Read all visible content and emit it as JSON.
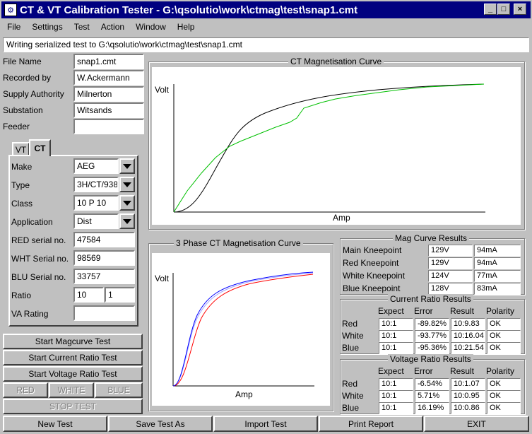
{
  "window": {
    "title": "CT & VT Calibration Tester - G:\\qsolutio\\work\\ctmag\\test\\snap1.cmt",
    "minimize": "_",
    "maximize": "□",
    "close": "×"
  },
  "menu": [
    "File",
    "Settings",
    "Test",
    "Action",
    "Window",
    "Help"
  ],
  "status": "Writing serialized test to G:\\qsolutio\\work\\ctmag\\test\\snap1.cmt",
  "info": {
    "file_name_label": "File Name",
    "file_name": "snap1.cmt",
    "recorded_by_label": "Recorded by",
    "recorded_by": "W.Ackermann",
    "supply_authority_label": "Supply Authority",
    "supply_authority": "Milnerton",
    "substation_label": "Substation",
    "substation": "Witsands",
    "feeder_label": "Feeder",
    "feeder": ""
  },
  "tabs": {
    "vt": "VT",
    "ct": "CT"
  },
  "ct": {
    "make_label": "Make",
    "make": "AEG",
    "type_label": "Type",
    "type": "3H/CT/938",
    "class_label": "Class",
    "class": "10 P 10",
    "application_label": "Application",
    "application": "Dist",
    "red_serial_label": "RED serial no.",
    "red_serial": "47584",
    "wht_serial_label": "WHT Serial no.",
    "wht_serial": "98569",
    "blu_serial_label": "BLU Serial no.",
    "blu_serial": "33757",
    "ratio_label": "Ratio",
    "ratio_primary": "10",
    "ratio_secondary": "1",
    "va_rating_label": "VA Rating",
    "va_rating": ""
  },
  "buttons": {
    "start_magcurve": "Start Magcurve Test",
    "start_current_ratio": "Start Current Ratio Test",
    "start_voltage_ratio": "Start Voltage Ratio Test",
    "red": "RED",
    "white": "WHITE",
    "blue": "BLUE",
    "stop": "STOP TEST"
  },
  "bottom": {
    "new_test": "New Test",
    "save_test_as": "Save Test As",
    "import_test": "Import Test",
    "print_report": "Print Report",
    "exit": "EXIT"
  },
  "ct_curve": {
    "title": "CT Magnetisation Curve",
    "ylabel": "Volt",
    "xlabel": "Amp"
  },
  "phase_curve": {
    "title": "3 Phase CT Magnetisation Curve",
    "ylabel": "Volt",
    "xlabel": "Amp"
  },
  "mag_results": {
    "title": "Mag Curve Results",
    "rows": [
      {
        "label": "Main Kneepoint",
        "v": "129V",
        "a": "94mA"
      },
      {
        "label": "Red Kneepoint",
        "v": "129V",
        "a": "94mA"
      },
      {
        "label": "White Kneepoint",
        "v": "124V",
        "a": "77mA"
      },
      {
        "label": "Blue Kneepoint",
        "v": "128V",
        "a": "83mA"
      }
    ]
  },
  "current_ratio": {
    "title": "Current Ratio Results",
    "headers": [
      "Expect",
      "Error",
      "Result",
      "Polarity"
    ],
    "rows": [
      {
        "label": "Red",
        "expect": "10:1",
        "error": "-89.82%",
        "result": "10:9.83",
        "polarity": "OK"
      },
      {
        "label": "White",
        "expect": "10:1",
        "error": "-93.77%",
        "result": "10:16.04",
        "polarity": "OK"
      },
      {
        "label": "Blue",
        "expect": "10:1",
        "error": "-95.36%",
        "result": "10:21.54",
        "polarity": "OK"
      }
    ]
  },
  "voltage_ratio": {
    "title": "Voltage Ratio Results",
    "headers": [
      "Expect",
      "Error",
      "Result",
      "Polarity"
    ],
    "rows": [
      {
        "label": "Red",
        "expect": "10:1",
        "error": "-6.54%",
        "result": "10:1.07",
        "polarity": "OK"
      },
      {
        "label": "White",
        "expect": "10:1",
        "error": "5.71%",
        "result": "10:0.95",
        "polarity": "OK"
      },
      {
        "label": "Blue",
        "expect": "10:1",
        "error": "16.19%",
        "result": "10:0.86",
        "polarity": "OK"
      }
    ]
  },
  "colors": {
    "titlebar": "#000080",
    "curve_main": "#000000",
    "curve_green": "#00c000",
    "curve_red": "#ff0000",
    "curve_blue": "#0000ff",
    "curve_white": "#a0a0ff"
  }
}
